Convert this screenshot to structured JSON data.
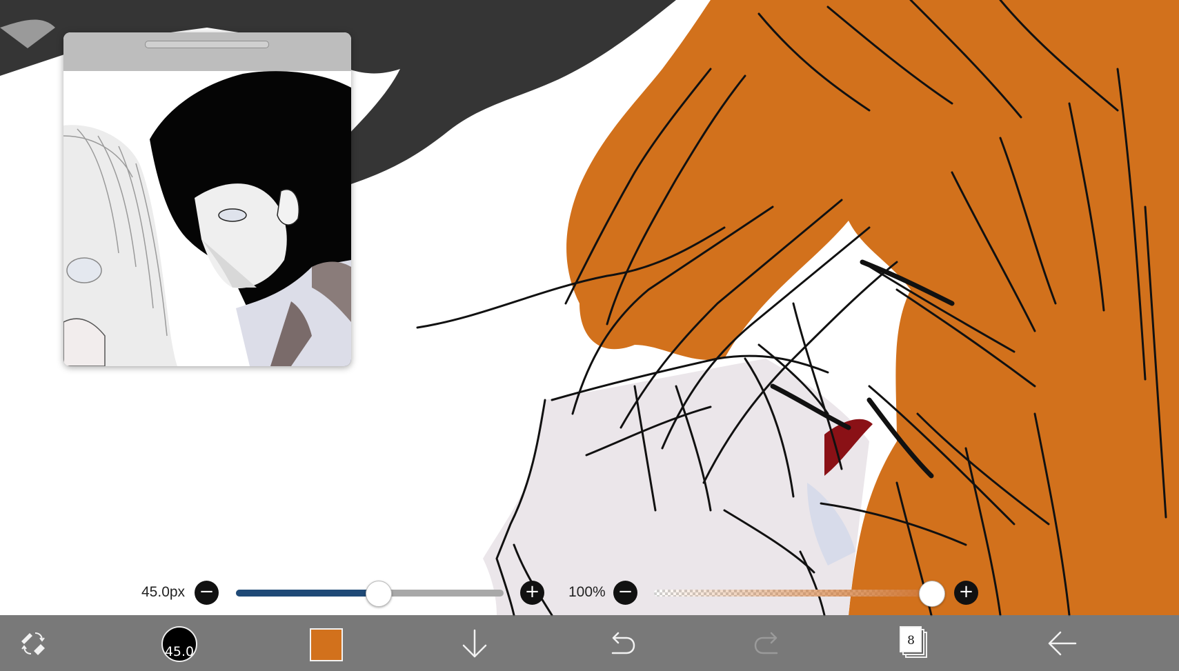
{
  "slider_row": {
    "brush_size_value": "45.0px",
    "brush_size_fraction": 0.53,
    "opacity_value": "100%",
    "opacity_fraction": 1.0,
    "minus_icon": "minus-icon",
    "plus_icon": "plus-icon"
  },
  "toolbar": {
    "tool_switch_icon": "pen-eraser-switch-icon",
    "brush_size_label": "45.0",
    "current_color": "#d2711c",
    "download_icon": "arrow-down-icon",
    "undo_icon": "undo-icon",
    "redo_icon": "redo-icon",
    "layer_count": "8",
    "back_icon": "arrow-left-icon"
  },
  "colors": {
    "hair_orange": "#d2711c",
    "slider_fill": "#1f4a77",
    "toolbar_bg": "#5f5f5f",
    "dark_hair": "#3a3a3a"
  },
  "reference_window": {
    "handle_icon": "drag-handle-icon"
  }
}
